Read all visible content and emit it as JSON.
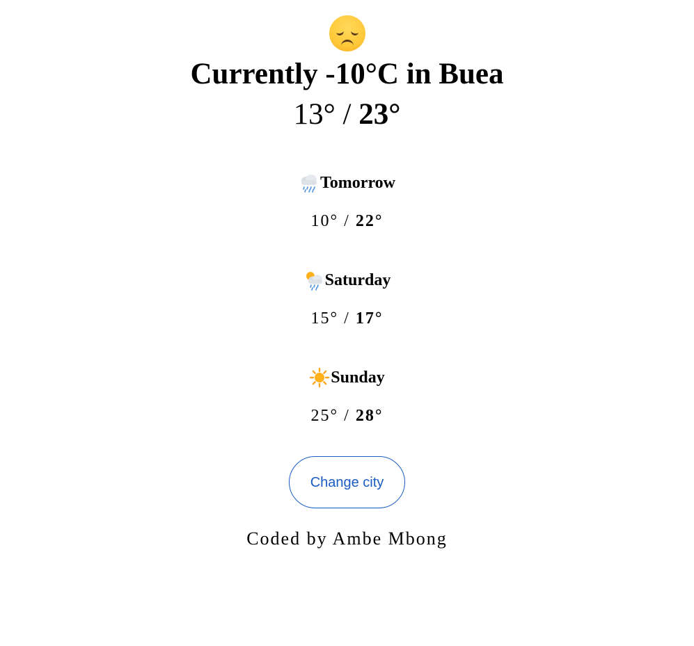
{
  "current": {
    "mood_icon": "disappointed-face-icon",
    "headline": "Currently -10°C in Buea",
    "low": "13°",
    "separator": " / ",
    "high": "23°"
  },
  "forecast": [
    {
      "icon": "rain-cloud-icon",
      "day": "Tomorrow",
      "low": "10°",
      "separator": " / ",
      "high": "22°"
    },
    {
      "icon": "sun-behind-rain-cloud-icon",
      "day": "Saturday",
      "low": "15°",
      "separator": " / ",
      "high": "17°"
    },
    {
      "icon": "sun-icon",
      "day": "Sunday",
      "low": "25°",
      "separator": " / ",
      "high": "28°"
    }
  ],
  "actions": {
    "change_city_label": "Change city"
  },
  "footer": {
    "credit": "Coded by Ambe Mbong"
  },
  "colors": {
    "button_accent": "#1a5cc6",
    "emoji_yellow": "#ffc93a"
  }
}
